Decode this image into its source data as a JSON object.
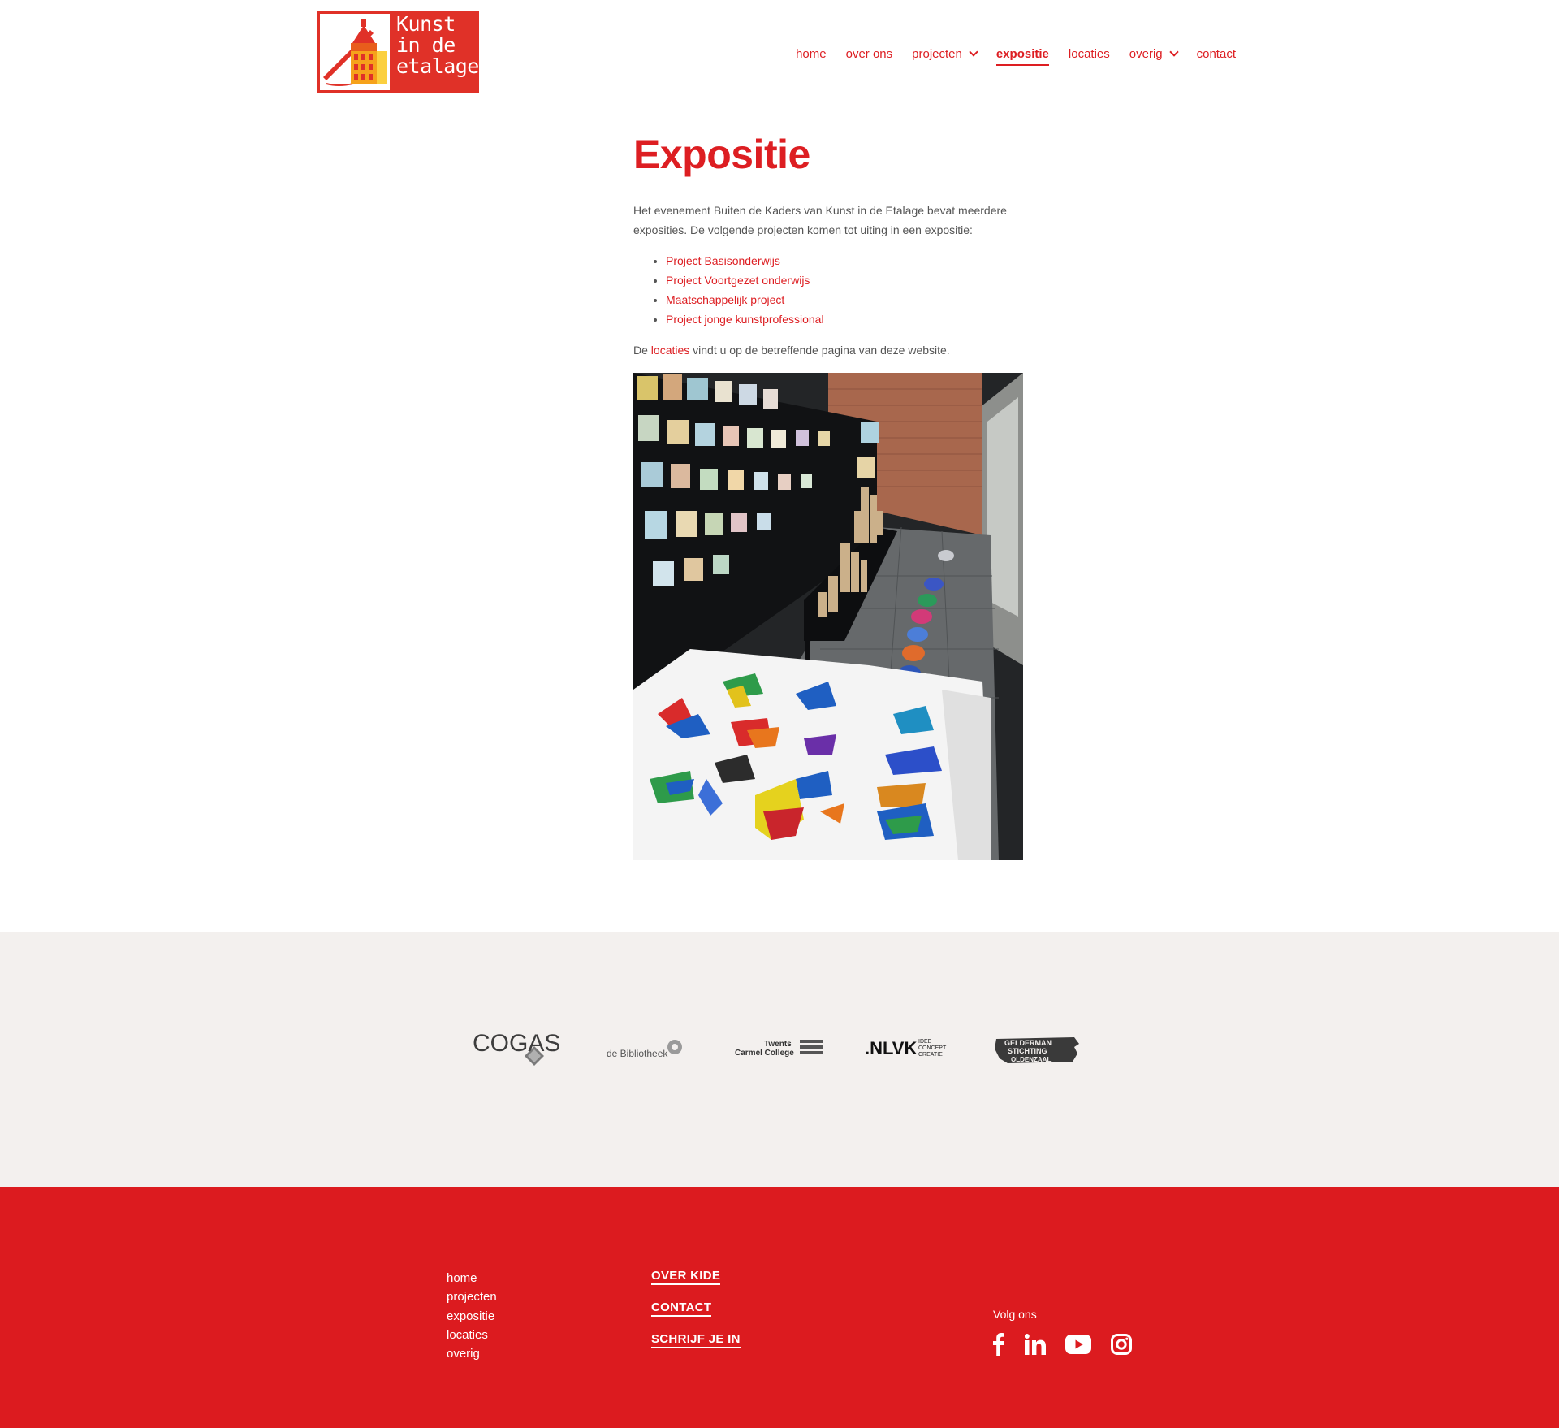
{
  "header": {
    "logo_lines": [
      "Kunst",
      "in de",
      "etalage"
    ],
    "nav": [
      {
        "label": "home"
      },
      {
        "label": "over ons"
      },
      {
        "label": "projecten"
      },
      {
        "label": "expositie"
      },
      {
        "label": "locaties"
      },
      {
        "label": "overig"
      },
      {
        "label": "contact"
      }
    ]
  },
  "main": {
    "title": "Expositie",
    "intro": "Het evenement Buiten de Kaders van Kunst in de Etalage bevat meerdere exposities. De volgende projecten komen tot uiting in een expositie:",
    "projects": [
      "Project Basisonderwijs",
      "Project Voortgezet onderwijs",
      "Maatschappelijk project",
      "Project jonge kunstprofessional"
    ],
    "locations_prefix": "De",
    "locations_link": "locaties",
    "locations_suffix": "vindt u op de betreffende pagina van deze website."
  },
  "sponsors": {
    "cogas": "COGAS",
    "bibliotheek": "de Bibliotheek",
    "carmel_1": "Twents",
    "carmel_2": "Carmel College",
    "nlvk": ".NLVK",
    "nlvk_tag": [
      "IDEE",
      "CONCEPT",
      "CREATIE"
    ],
    "gelderman": [
      "GELDERMAN",
      "STICHTING",
      "OLDENZAAL"
    ]
  },
  "footer": {
    "nav": [
      "home",
      "projecten",
      "expositie",
      "locaties",
      "overig"
    ],
    "buttons": [
      "OVER KIDE",
      "CONTACT",
      "SCHRIJF JE IN"
    ],
    "follow_label": "Volg ons",
    "socials": [
      "facebook-icon",
      "linkedin-icon",
      "youtube-icon",
      "instagram-icon"
    ]
  },
  "colors": {
    "brand_red": "#dd1e22",
    "footer_red": "#dc1b1f",
    "sponsor_band": "#f3f0ee",
    "logo_red": "#e03128"
  }
}
